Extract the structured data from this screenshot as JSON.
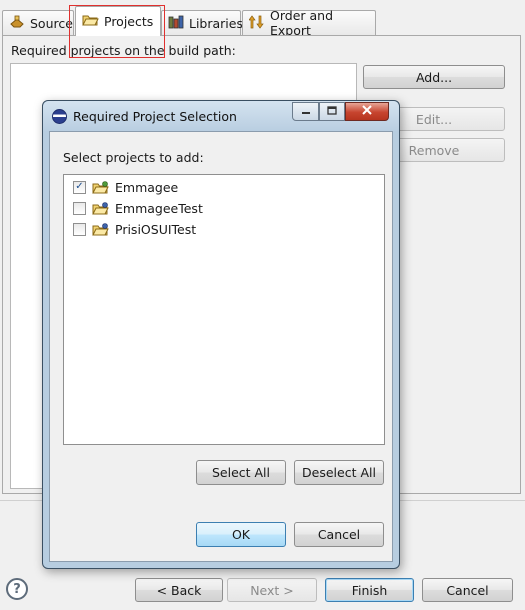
{
  "tabs": [
    {
      "label": "Source",
      "icon": "source-icon"
    },
    {
      "label": "Projects",
      "icon": "projects-folder-icon",
      "active": true
    },
    {
      "label": "Libraries",
      "icon": "libraries-icon"
    },
    {
      "label": "Order and Export",
      "icon": "order-export-icon"
    }
  ],
  "panel": {
    "label": "Required projects on the build path:",
    "buttons": {
      "add": "Add...",
      "edit": "Edit...",
      "remove": "Remove"
    }
  },
  "dialog": {
    "title": "Required Project Selection",
    "instruction": "Select projects to add:",
    "projects": [
      {
        "name": "Emmagee",
        "checked": true
      },
      {
        "name": "EmmageeTest",
        "checked": false
      },
      {
        "name": "PrisiOSUITest",
        "checked": false
      }
    ],
    "select_all": "Select All",
    "deselect_all": "Deselect All",
    "ok": "OK",
    "cancel": "Cancel"
  },
  "footer": {
    "help": "?",
    "back": "< Back",
    "next": "Next >",
    "finish": "Finish",
    "cancel": "Cancel"
  }
}
